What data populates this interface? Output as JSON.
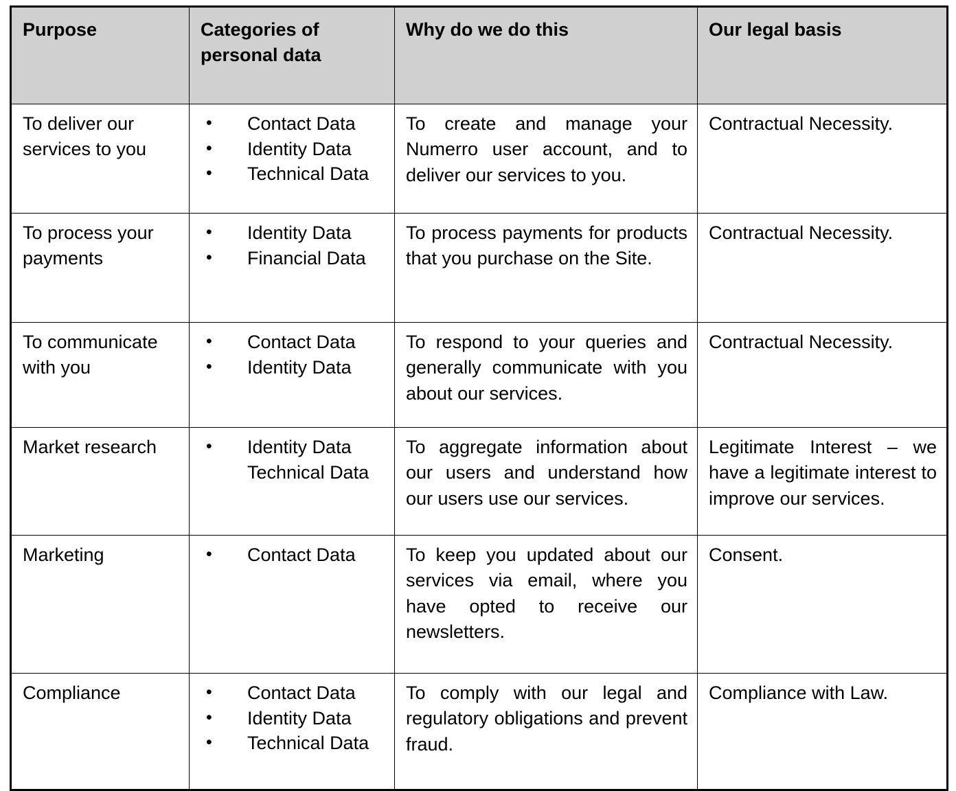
{
  "table": {
    "headers": [
      "Purpose",
      "Categories of personal data",
      "Why do we do this",
      "Our legal basis"
    ],
    "header_background": "#d0d0d0",
    "border_color": "#000000",
    "bullet_glyph": "•",
    "rows": [
      {
        "purpose": "To deliver our services to you",
        "categories": [
          {
            "label": "Contact Data",
            "bullet": true
          },
          {
            "label": "Identity Data",
            "bullet": true
          },
          {
            "label": "Technical Data",
            "bullet": true
          }
        ],
        "why": "To create and manage your Numerro user account, and to deliver our services to you.",
        "basis": "Contractual Necessity."
      },
      {
        "purpose": "To process your payments",
        "categories": [
          {
            "label": "Identity Data",
            "bullet": true
          },
          {
            "label": "Financial Data",
            "bullet": true
          }
        ],
        "why": "To process payments for products that you purchase on the Site.",
        "basis": "Contractual Necessity."
      },
      {
        "purpose": "To communicate with you",
        "categories": [
          {
            "label": "Contact Data",
            "bullet": true
          },
          {
            "label": "Identity Data",
            "bullet": true
          }
        ],
        "why": "To respond to your queries and generally communicate with you about our services.",
        "basis": "Contractual Necessity."
      },
      {
        "purpose": "Market research",
        "categories": [
          {
            "label": "Identity Data",
            "bullet": true
          },
          {
            "label": "Technical Data",
            "bullet": false
          }
        ],
        "why": "To aggregate information about our users and understand how our users use our services.",
        "basis": "Legitimate Interest – we have a legitimate interest to improve our services."
      },
      {
        "purpose": "Marketing",
        "categories": [
          {
            "label": "Contact Data",
            "bullet": true
          }
        ],
        "why": "To keep you updated about our services via email, where you have opted to receive our newsletters.",
        "basis": "Consent."
      },
      {
        "purpose": "Compliance",
        "categories": [
          {
            "label": "Contact Data",
            "bullet": true
          },
          {
            "label": "Identity Data",
            "bullet": true
          },
          {
            "label": "Technical Data",
            "bullet": true
          }
        ],
        "why": "To comply with our legal and regulatory obligations and prevent fraud.",
        "basis": "Compliance with Law."
      }
    ]
  }
}
